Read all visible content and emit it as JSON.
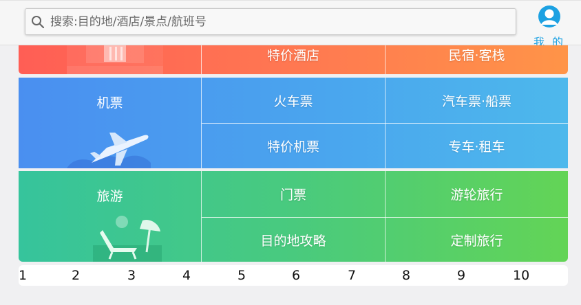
{
  "search": {
    "placeholder": "搜索:目的地/酒店/景点/航班号"
  },
  "profile": {
    "label": "我 的"
  },
  "hotel_row": {
    "items": [
      "特价酒店",
      "民宿·客栈"
    ]
  },
  "transport": {
    "main": "机票",
    "items": [
      "火车票",
      "汽车票·船票",
      "特价机票",
      "专车·租车"
    ]
  },
  "travel": {
    "main": "旅游",
    "items": [
      "门票",
      "游轮旅行",
      "目的地攻略",
      "定制旅行"
    ]
  },
  "pagination": [
    "1",
    "2",
    "3",
    "4",
    "5",
    "6",
    "7",
    "8",
    "9",
    "10"
  ],
  "colors": {
    "hotel_gradient": [
      "#ff5e55",
      "#ff9448"
    ],
    "transport_gradient": [
      "#4a8ff0",
      "#4db8ec"
    ],
    "travel_gradient": [
      "#36c49c",
      "#63d456"
    ],
    "accent": "#1ca1e2"
  },
  "icons": [
    "search-icon",
    "user-avatar-icon",
    "airplane-icon",
    "beach-chair-icon",
    "hotel-building-icon"
  ]
}
